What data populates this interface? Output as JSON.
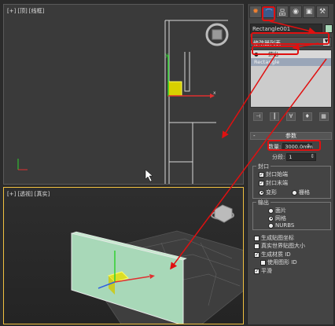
{
  "viewport_top": {
    "labels": [
      "[+]",
      "[顶]",
      "[线框]"
    ]
  },
  "viewport_persp": {
    "labels": [
      "[+]",
      "[透视]",
      "[真实]"
    ]
  },
  "panel": {
    "tabs": [
      "create-tab",
      "modify-tab",
      "hierarchy-tab",
      "motion-tab",
      "display-tab",
      "utilities-tab"
    ],
    "object_name": "Rectangle001",
    "modifier_list_label": "修改器列表",
    "stack": {
      "modifier": "挤出",
      "base": "Rectangle"
    },
    "params_title": "参数",
    "amount_label": "数量:",
    "amount_value": "3000.0mm",
    "segments_label": "分段:",
    "segments_value": "1",
    "capping_title": "封口",
    "cap_start": "封口始端",
    "cap_end": "封口末端",
    "morph": "变形",
    "grid": "栅格",
    "output_title": "输出",
    "out_patch": "面片",
    "out_mesh": "网格",
    "out_nurbs": "NURBS",
    "gen_mapping": "生成贴图坐标",
    "real_world": "真实世界贴图大小",
    "gen_matid": "生成材质 ID",
    "use_shape_id": "使用图形 ID",
    "smooth": "平滑"
  },
  "colors": {
    "annotation_red": "#e01010",
    "selection_yellow": "#f0c040",
    "wall_green": "#a8d8b8"
  }
}
